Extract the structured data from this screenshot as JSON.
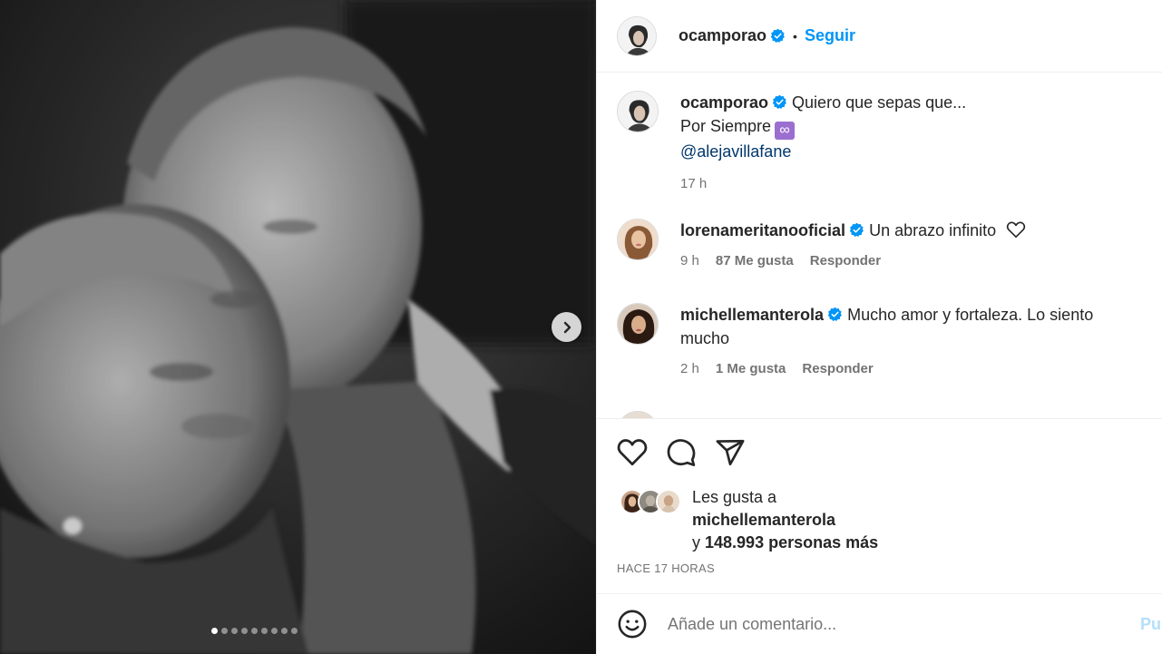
{
  "post": {
    "author": "ocamporao",
    "follow_label": "Seguir",
    "separator": "•",
    "slides_total": 9,
    "slide_active": 1
  },
  "caption": {
    "username": "ocamporao",
    "line1": "Quiero que sepas que...",
    "line2": "Por Siempre",
    "infinity_emoji": "∞",
    "mention": "@alejavillafane",
    "time": "17 h"
  },
  "comments": [
    {
      "username": "lorenameritanooficial",
      "text": "Un abrazo infinito",
      "time": "9 h",
      "likes": "87 Me gusta",
      "reply": "Responder"
    },
    {
      "username": "michellemanterola",
      "text": "Mucho amor y fortaleza. Lo siento mucho",
      "time": "2 h",
      "likes": "1 Me gusta",
      "reply": "Responder"
    }
  ],
  "likes": {
    "prefix": "Les gusta a",
    "user": "michellemanterola",
    "conj": "y",
    "count": "148.993 personas más"
  },
  "posted_ago": "HACE 17 HORAS",
  "compose": {
    "placeholder": "Añade un comentario...",
    "post_label": "Publicar"
  },
  "colors": {
    "link_blue": "#0095f6",
    "mention_blue": "#00376b",
    "muted": "#737373",
    "verified": "#0095f6"
  },
  "icons": [
    "chevron-right-icon",
    "verified-badge-icon",
    "heart-icon",
    "comment-icon",
    "share-icon",
    "emoji-icon"
  ]
}
